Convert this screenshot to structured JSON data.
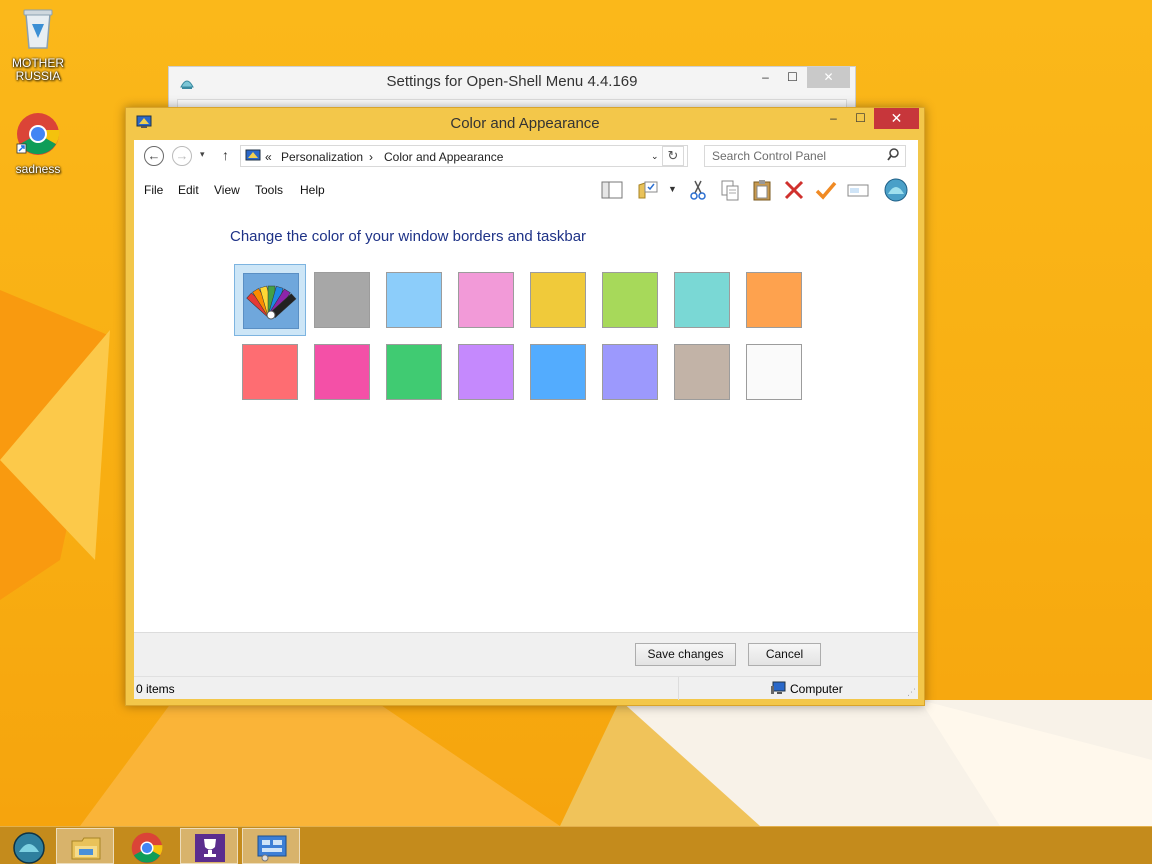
{
  "desktop": {
    "icons": [
      {
        "label": "MOTHER RUSSIA",
        "icon": "recycle-bin-icon"
      },
      {
        "label": "sadness",
        "icon": "chrome-icon"
      }
    ]
  },
  "back_window": {
    "title": "Settings for Open-Shell Menu 4.4.169",
    "controls": {
      "minimize": "–",
      "maximize": "☐",
      "close": "✕"
    }
  },
  "window": {
    "title": "Color and Appearance",
    "controls": {
      "minimize": "–",
      "maximize": "☐",
      "close": "✕"
    },
    "nav": {
      "back": "←",
      "forward": "→",
      "recent": "▾",
      "up": "↑"
    },
    "breadcrumb": {
      "prefix": "«",
      "items": [
        "Personalization",
        "Color and Appearance"
      ],
      "separator": "›"
    },
    "search": {
      "placeholder": "Search Control Panel"
    },
    "menu": [
      "File",
      "Edit",
      "View",
      "Tools",
      "Help"
    ],
    "toolbar_icons": [
      "layout-pane-icon",
      "folder-options-icon",
      "cut-icon",
      "copy-icon",
      "paste-icon",
      "delete-icon",
      "properties-check-icon",
      "rename-icon",
      "open-shell-icon"
    ],
    "heading": "Change the color of your window borders and taskbar",
    "swatches": {
      "selected_index": 0,
      "colors": [
        "color-picker",
        "#a7a7a7",
        "#8ccdfa",
        "#f29ad8",
        "#f0ca3a",
        "#a7d95a",
        "#7ad8d5",
        "#fea24e",
        "#fe6d72",
        "#f450a7",
        "#40cb72",
        "#c589fd",
        "#53acfe",
        "#9c99fd",
        "#c2b3a7",
        "#fafafa"
      ]
    },
    "buttons": {
      "save": "Save changes",
      "cancel": "Cancel"
    },
    "status": {
      "items": "0 items",
      "location": "Computer"
    }
  },
  "taskbar": {
    "items": [
      "start-icon",
      "file-explorer-icon",
      "chrome-icon",
      "trophy-icon",
      "control-panel-icon"
    ],
    "active_indices": [
      1,
      3,
      4
    ]
  },
  "colors": {
    "window_frame": "#f3c74a",
    "close_button": "#c7363b",
    "heading_text": "#1e3287",
    "taskbar": "#c48b1c"
  }
}
